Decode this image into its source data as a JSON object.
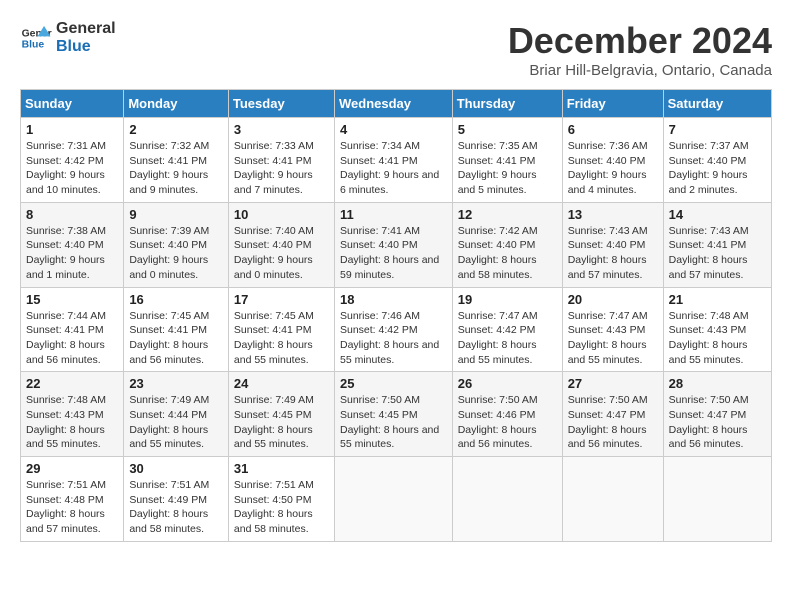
{
  "logo": {
    "line1": "General",
    "line2": "Blue"
  },
  "title": "December 2024",
  "subtitle": "Briar Hill-Belgravia, Ontario, Canada",
  "headers": [
    "Sunday",
    "Monday",
    "Tuesday",
    "Wednesday",
    "Thursday",
    "Friday",
    "Saturday"
  ],
  "weeks": [
    [
      {
        "day": "1",
        "sunrise": "7:31 AM",
        "sunset": "4:42 PM",
        "daylight": "9 hours and 10 minutes."
      },
      {
        "day": "2",
        "sunrise": "7:32 AM",
        "sunset": "4:41 PM",
        "daylight": "9 hours and 9 minutes."
      },
      {
        "day": "3",
        "sunrise": "7:33 AM",
        "sunset": "4:41 PM",
        "daylight": "9 hours and 7 minutes."
      },
      {
        "day": "4",
        "sunrise": "7:34 AM",
        "sunset": "4:41 PM",
        "daylight": "9 hours and 6 minutes."
      },
      {
        "day": "5",
        "sunrise": "7:35 AM",
        "sunset": "4:41 PM",
        "daylight": "9 hours and 5 minutes."
      },
      {
        "day": "6",
        "sunrise": "7:36 AM",
        "sunset": "4:40 PM",
        "daylight": "9 hours and 4 minutes."
      },
      {
        "day": "7",
        "sunrise": "7:37 AM",
        "sunset": "4:40 PM",
        "daylight": "9 hours and 2 minutes."
      }
    ],
    [
      {
        "day": "8",
        "sunrise": "7:38 AM",
        "sunset": "4:40 PM",
        "daylight": "9 hours and 1 minute."
      },
      {
        "day": "9",
        "sunrise": "7:39 AM",
        "sunset": "4:40 PM",
        "daylight": "9 hours and 0 minutes."
      },
      {
        "day": "10",
        "sunrise": "7:40 AM",
        "sunset": "4:40 PM",
        "daylight": "9 hours and 0 minutes."
      },
      {
        "day": "11",
        "sunrise": "7:41 AM",
        "sunset": "4:40 PM",
        "daylight": "8 hours and 59 minutes."
      },
      {
        "day": "12",
        "sunrise": "7:42 AM",
        "sunset": "4:40 PM",
        "daylight": "8 hours and 58 minutes."
      },
      {
        "day": "13",
        "sunrise": "7:43 AM",
        "sunset": "4:40 PM",
        "daylight": "8 hours and 57 minutes."
      },
      {
        "day": "14",
        "sunrise": "7:43 AM",
        "sunset": "4:41 PM",
        "daylight": "8 hours and 57 minutes."
      }
    ],
    [
      {
        "day": "15",
        "sunrise": "7:44 AM",
        "sunset": "4:41 PM",
        "daylight": "8 hours and 56 minutes."
      },
      {
        "day": "16",
        "sunrise": "7:45 AM",
        "sunset": "4:41 PM",
        "daylight": "8 hours and 56 minutes."
      },
      {
        "day": "17",
        "sunrise": "7:45 AM",
        "sunset": "4:41 PM",
        "daylight": "8 hours and 55 minutes."
      },
      {
        "day": "18",
        "sunrise": "7:46 AM",
        "sunset": "4:42 PM",
        "daylight": "8 hours and 55 minutes."
      },
      {
        "day": "19",
        "sunrise": "7:47 AM",
        "sunset": "4:42 PM",
        "daylight": "8 hours and 55 minutes."
      },
      {
        "day": "20",
        "sunrise": "7:47 AM",
        "sunset": "4:43 PM",
        "daylight": "8 hours and 55 minutes."
      },
      {
        "day": "21",
        "sunrise": "7:48 AM",
        "sunset": "4:43 PM",
        "daylight": "8 hours and 55 minutes."
      }
    ],
    [
      {
        "day": "22",
        "sunrise": "7:48 AM",
        "sunset": "4:43 PM",
        "daylight": "8 hours and 55 minutes."
      },
      {
        "day": "23",
        "sunrise": "7:49 AM",
        "sunset": "4:44 PM",
        "daylight": "8 hours and 55 minutes."
      },
      {
        "day": "24",
        "sunrise": "7:49 AM",
        "sunset": "4:45 PM",
        "daylight": "8 hours and 55 minutes."
      },
      {
        "day": "25",
        "sunrise": "7:50 AM",
        "sunset": "4:45 PM",
        "daylight": "8 hours and 55 minutes."
      },
      {
        "day": "26",
        "sunrise": "7:50 AM",
        "sunset": "4:46 PM",
        "daylight": "8 hours and 56 minutes."
      },
      {
        "day": "27",
        "sunrise": "7:50 AM",
        "sunset": "4:47 PM",
        "daylight": "8 hours and 56 minutes."
      },
      {
        "day": "28",
        "sunrise": "7:50 AM",
        "sunset": "4:47 PM",
        "daylight": "8 hours and 56 minutes."
      }
    ],
    [
      {
        "day": "29",
        "sunrise": "7:51 AM",
        "sunset": "4:48 PM",
        "daylight": "8 hours and 57 minutes."
      },
      {
        "day": "30",
        "sunrise": "7:51 AM",
        "sunset": "4:49 PM",
        "daylight": "8 hours and 58 minutes."
      },
      {
        "day": "31",
        "sunrise": "7:51 AM",
        "sunset": "4:50 PM",
        "daylight": "8 hours and 58 minutes."
      },
      null,
      null,
      null,
      null
    ]
  ],
  "labels": {
    "sunrise": "Sunrise:",
    "sunset": "Sunset:",
    "daylight": "Daylight:"
  }
}
